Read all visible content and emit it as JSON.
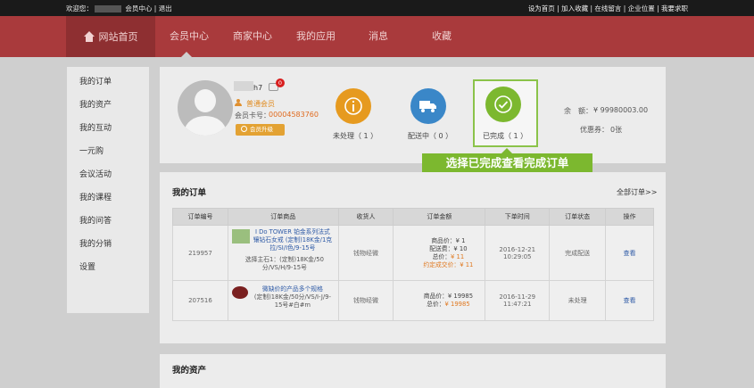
{
  "topbar": {
    "welcome": "欢迎您：",
    "member_center": "会员中心",
    "logout": "退出",
    "right_links": [
      "设为首页",
      "加入收藏",
      "在线留言",
      "企业位置",
      "我要求职"
    ]
  },
  "nav": {
    "home": "网站首页",
    "items": [
      "会员中心",
      "商家中心",
      "我的应用",
      "消息",
      "收藏"
    ]
  },
  "sidebar": {
    "items": [
      "我的订单",
      "我的资产",
      "我的互动",
      "一元购",
      "会议活动",
      "我的课程",
      "我的问答",
      "我的分销",
      "设置"
    ]
  },
  "profile": {
    "name_suffix": "h7",
    "message_count": "0",
    "level": "普通会员",
    "card_label": "会员卡号：",
    "card_no": "00004583760",
    "upgrade_label": "会员升级"
  },
  "status": {
    "pending": "未处理（ 1 ）",
    "shipping": "配送中（ 0 ）",
    "done": "已完成（ 1 ）"
  },
  "balance": {
    "balance_label": "余　额：",
    "balance_value": "¥ 99980003.00",
    "coupon_label": "优惠券：",
    "coupon_value": "0张"
  },
  "tooltip": "选择已完成查看完成订单",
  "orders": {
    "title": "我的订单",
    "all_link": "全部订单>>",
    "headers": [
      "订单编号",
      "订单商品",
      "收货人",
      "订单金额",
      "下单时间",
      "订单状态",
      "操作"
    ],
    "rows": [
      {
        "id": "219957",
        "product_title": "I Do TOWER 铂金系列法式镶钻石女戒 (定制)18K金/1克拉/SI/I色/9-15号",
        "product_spec": "选择主石1：(定制)18K金/50分/VS/H/9-15号",
        "receiver": "钱物经微",
        "price_lines": [
          "商品价：¥ 1",
          "配送费：¥ 10",
          "总价：",
          "¥ 11",
          "约定成交价：",
          "¥ 11"
        ],
        "time": "2016-12-21 10:29:05",
        "status": "完成配送",
        "action": "查看"
      },
      {
        "id": "207516",
        "product_title": "微缺价的产品多个规格",
        "product_spec": "(定制)18K金/50分/VS/I-J/9-15号#白#m",
        "receiver": "钱物经微",
        "price_lines": [
          "商品价：¥ 19985",
          "总价：",
          "¥ 19985"
        ],
        "time": "2016-11-29 11:47:21",
        "status": "未处理",
        "action": "查看"
      }
    ]
  },
  "assets": {
    "title": "我的资产"
  },
  "colors": {
    "nav": "#a93a3c",
    "pending": "#e69a1f",
    "shipping": "#3a87c8",
    "done": "#7cb82f"
  }
}
